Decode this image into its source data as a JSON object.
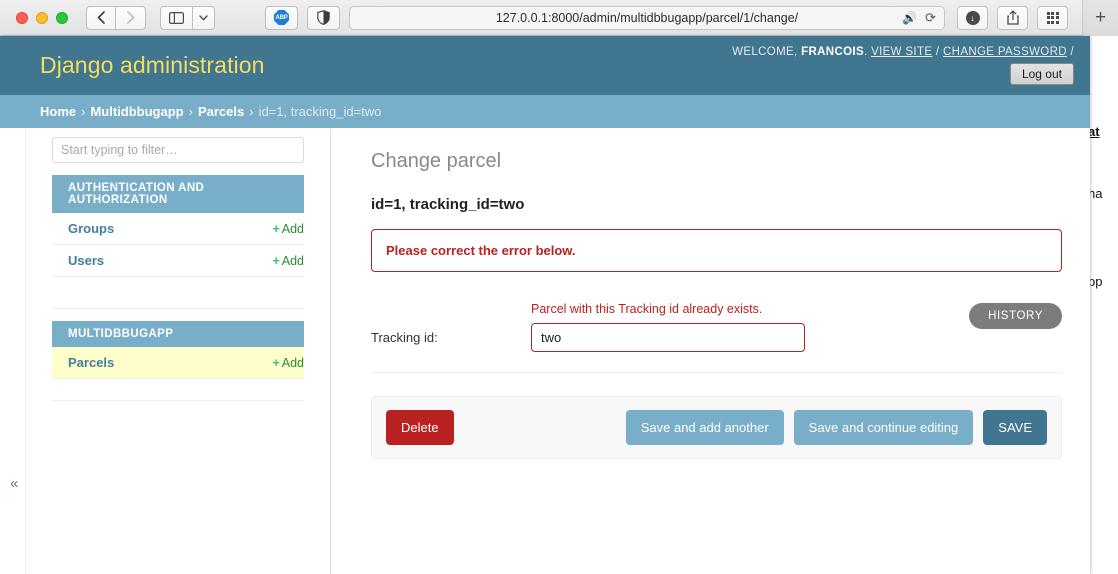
{
  "browser": {
    "back_icon": "chevron-left-icon",
    "forward_icon": "chevron-right-icon",
    "sidebar_icon": "sidebar-panel-icon",
    "dropdown_icon": "chevron-down-icon",
    "abp_label": "ABP",
    "shield_icon": "shield-icon",
    "url": "127.0.0.1:8000/admin/multidbbugapp/parcel/1/change/",
    "speaker_icon": "speaker-icon",
    "reload_icon": "reload-icon",
    "download_icon": "download-icon",
    "share_icon": "share-icon",
    "tabs_grid_icon": "tab-grid-icon",
    "new_tab_label": "+"
  },
  "background_page": {
    "fragment_1": "at",
    "fragment_2": "ha",
    "fragment_3": "pp"
  },
  "header": {
    "branding": "Django administration",
    "welcome_prefix": "WELCOME, ",
    "username": "FRANCOIS",
    "welcome_suffix": ".",
    "view_site": "VIEW SITE",
    "separator_1": " / ",
    "change_password": "CHANGE PASSWORD",
    "separator_2": " /",
    "logout": "Log out"
  },
  "breadcrumbs": {
    "home": "Home",
    "app": "Multidbbugapp",
    "model": "Parcels",
    "current": "id=1, tracking_id=two",
    "separator": "›"
  },
  "sidebar": {
    "filter_placeholder": "Start typing to filter…",
    "filter_value": "",
    "collapse_icon": "«",
    "apps": [
      {
        "caption": "AUTHENTICATION AND AUTHORIZATION",
        "models": [
          {
            "name": "Groups",
            "add_label": "Add",
            "add_plus": "+",
            "current": false
          },
          {
            "name": "Users",
            "add_label": "Add",
            "add_plus": "+",
            "current": false
          }
        ]
      },
      {
        "caption": "MULTIDBBUGAPP",
        "models": [
          {
            "name": "Parcels",
            "add_label": "Add",
            "add_plus": "+",
            "current": true
          }
        ]
      }
    ]
  },
  "content": {
    "page_title": "Change parcel",
    "object_name": "id=1, tracking_id=two",
    "history_button": "HISTORY",
    "error_note": "Please correct the error below.",
    "field": {
      "error": "Parcel with this Tracking id already exists.",
      "label": "Tracking id:",
      "value": "two"
    },
    "buttons": {
      "delete": "Delete",
      "save_add_another": "Save and add another",
      "save_continue": "Save and continue editing",
      "save": "SAVE"
    }
  },
  "colors": {
    "django_header": "#417690",
    "django_breadcrumb": "#79aec8",
    "branding_yellow": "#f5dd5d",
    "error_red": "#ba2121",
    "add_green": "#44b78b",
    "current_row": "#ffffcc"
  }
}
